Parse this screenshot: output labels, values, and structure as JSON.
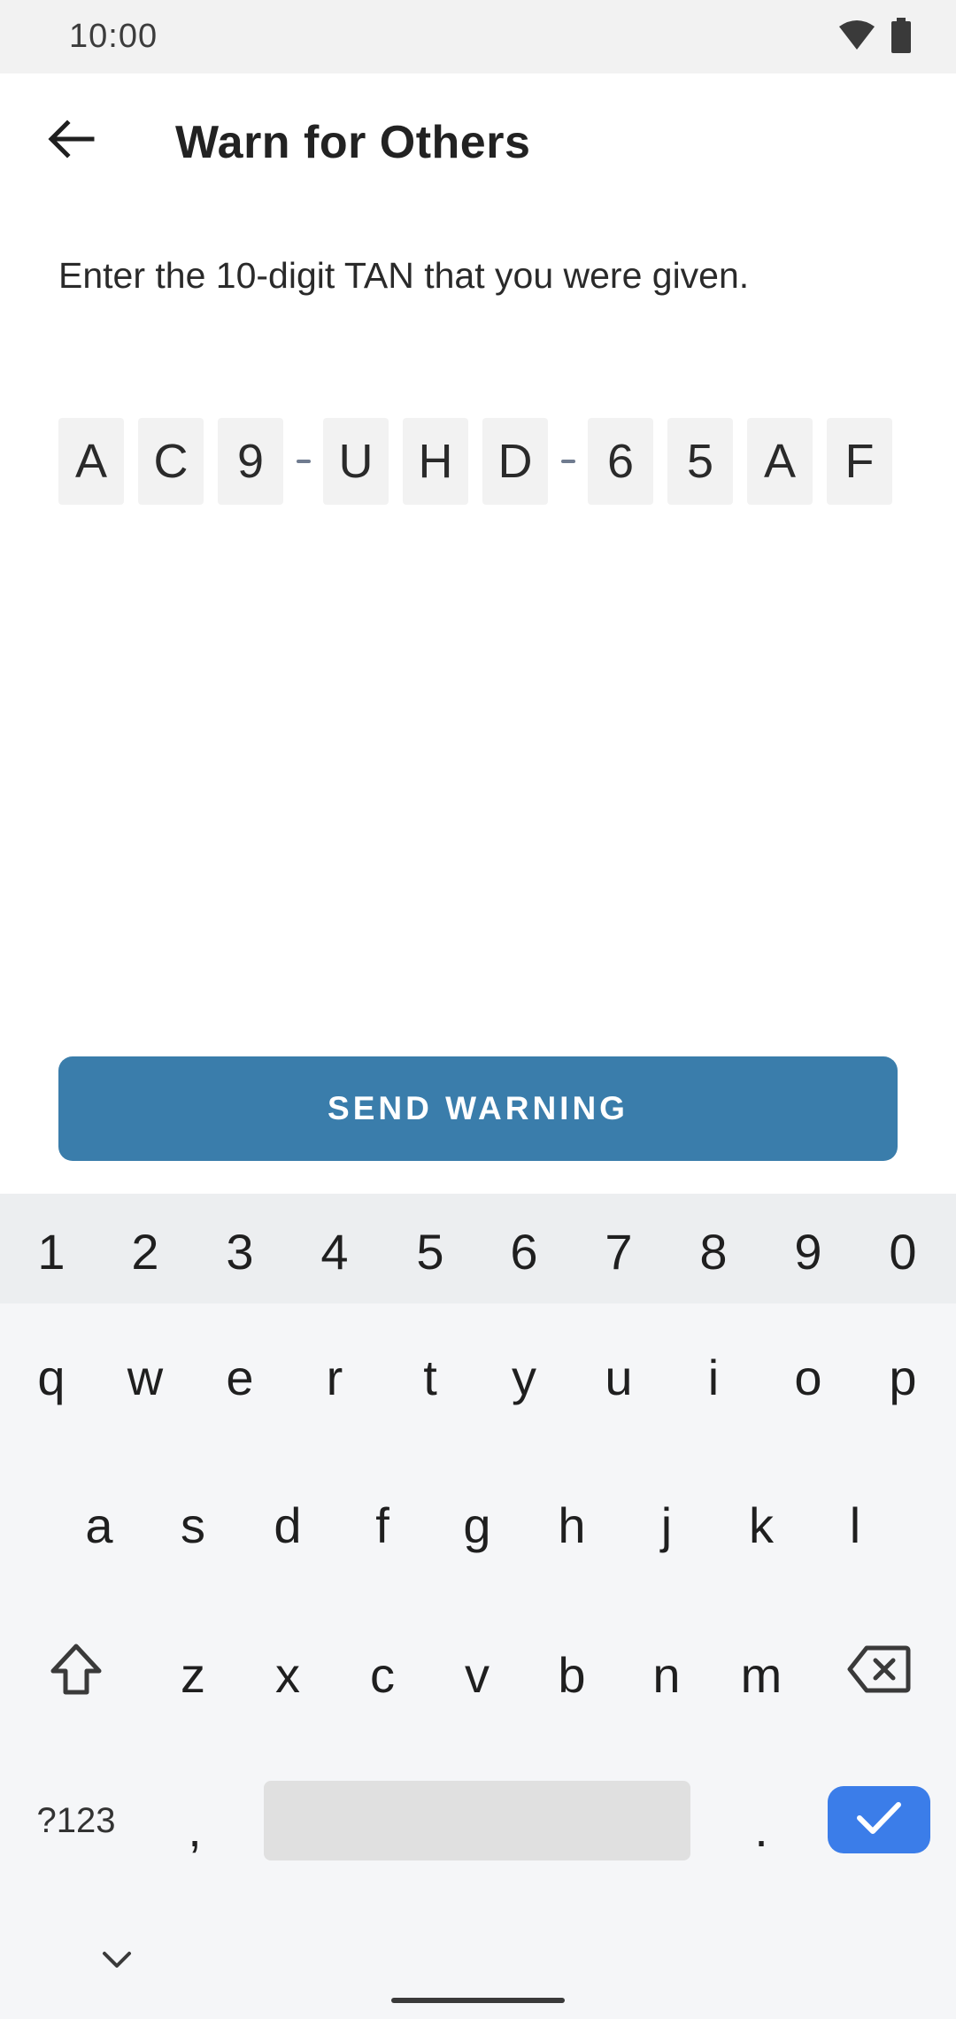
{
  "status_bar": {
    "time": "10:00",
    "icons": [
      "wifi-icon",
      "battery-icon"
    ]
  },
  "app_bar": {
    "back_icon": "arrow-back-icon",
    "title": "Warn for Others"
  },
  "content": {
    "instruction": "Enter the 10-digit TAN that you were given.",
    "tan_chars": [
      "A",
      "C",
      "9",
      "U",
      "H",
      "D",
      "6",
      "5",
      "A",
      "F"
    ],
    "send_label": "SEND WARNING"
  },
  "keyboard": {
    "numbers": [
      "1",
      "2",
      "3",
      "4",
      "5",
      "6",
      "7",
      "8",
      "9",
      "0"
    ],
    "row1": [
      "q",
      "w",
      "e",
      "r",
      "t",
      "y",
      "u",
      "i",
      "o",
      "p"
    ],
    "row2": [
      "a",
      "s",
      "d",
      "f",
      "g",
      "h",
      "j",
      "k",
      "l"
    ],
    "row3": [
      "z",
      "x",
      "c",
      "v",
      "b",
      "n",
      "m"
    ],
    "symbols_label": "?123",
    "comma": ",",
    "period": ".",
    "shift_icon": "shift-icon",
    "backspace_icon": "backspace-icon",
    "done_icon": "check-icon",
    "collapse_icon": "chevron-down-icon"
  },
  "colors": {
    "send_button": "#3a7dab",
    "done_key": "#3b7de9",
    "tan_cell_bg": "#f2f2f2"
  }
}
